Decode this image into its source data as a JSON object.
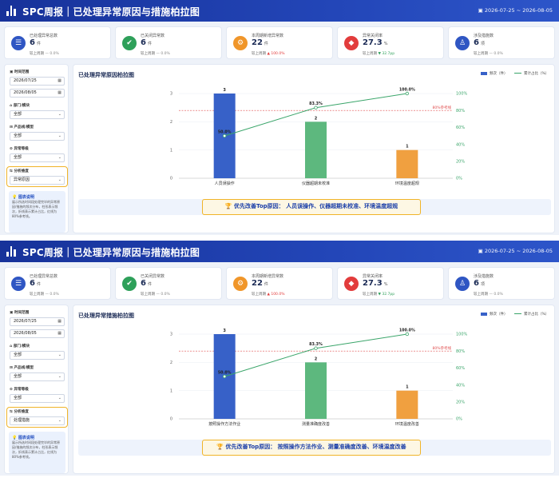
{
  "header": {
    "title": "SPC周报｜已处理异常原因与措施柏拉图",
    "date_range": "▣ 2026-07-25 ~ 2026-08-05"
  },
  "kpis": [
    {
      "label": "已处理异常总数",
      "value": "6",
      "unit": "件",
      "compare": "较上周期 — 0.0%",
      "trend": "flat",
      "icon": "list-icon",
      "glyph": "☰",
      "color": "#2f56c3"
    },
    {
      "label": "已关闭异常数",
      "value": "6",
      "unit": "件",
      "compare": "较上周期 — 0.0%",
      "trend": "flat",
      "icon": "check-icon",
      "glyph": "✔",
      "color": "#2ea05a"
    },
    {
      "label": "本周期新增异常数",
      "value": "22",
      "unit": "件",
      "compare": "较上周期 ▲ 100.0%",
      "trend": "up",
      "icon": "gear-icon",
      "glyph": "⚙",
      "color": "#f0962a"
    },
    {
      "label": "异常关闭率",
      "value": "27.3",
      "unit": "%",
      "compare": "较上周期 ▼ 32.7pp",
      "trend": "down",
      "icon": "diamond-icon",
      "glyph": "◆",
      "color": "#e23c3c"
    },
    {
      "label": "涉及措施数",
      "value": "6",
      "unit": "项",
      "compare": "较上周期 — 0.0%",
      "trend": "flat",
      "icon": "flask-icon",
      "glyph": "♙",
      "color": "#2f56c3"
    }
  ],
  "filters": {
    "time_label": "▣ 时间范围",
    "date_start": "2026/07/25",
    "date_end": "2026/08/05",
    "dept_label": "⌂ 部门/模块",
    "dept_value": "全部",
    "line_label": "⊞ 产品线/模型",
    "line_value": "全部",
    "level_label": "⊙ 异常等级",
    "level_value": "全部",
    "dim_label": "⇆ 分析维度",
    "note_title": "💡 图表说明",
    "note_body": "展示所选时间段处理完毕的异常原因/措施的频次分布，柱形表示频次，折线表示累计占比，红线为80%参考线。"
  },
  "legend": {
    "bar": "频次（件）",
    "line": "累计占比（%）"
  },
  "frames": [
    {
      "dimension_value": "异常原因",
      "chart_title": "已处理异常原因柏拉图",
      "banner": "🏆 优先改善Top原因： 人员误操作、仪器超期未校准、环境温度超规",
      "chart_data": {
        "type": "bar",
        "categories": [
          "人员误操作",
          "仪器超期未校准",
          "环境温度超规"
        ],
        "series": [
          {
            "name": "频次（件）",
            "kind": "bar",
            "values": [
              3,
              2,
              1
            ],
            "colors": [
              "#3761c8",
              "#5db87e",
              "#f0a040"
            ]
          },
          {
            "name": "累计占比（%）",
            "kind": "line",
            "values": [
              50.0,
              83.3,
              100.0
            ],
            "labels": [
              "50.0%",
              "83.3%",
              "100.0%"
            ],
            "color": "#3aa56a"
          }
        ],
        "ylim": [
          0,
          3
        ],
        "yticks": [
          "0",
          "1",
          "2",
          "3"
        ],
        "y2lim": [
          0,
          100
        ],
        "y2ticks": [
          "0%",
          "20%",
          "40%",
          "60%",
          "80%",
          "100%"
        ],
        "bar_labels": [
          "3",
          "2",
          "1"
        ],
        "reference": {
          "value": 80,
          "label": "80%参考线",
          "color": "#e05050"
        },
        "legend": "top-right"
      }
    },
    {
      "dimension_value": "处理措施",
      "chart_title": "已处理异常措施柏拉图",
      "banner": "🏆 优先改善Top原因： 按照操作方法作业、测量准确度改善、环境温度改善",
      "chart_data": {
        "type": "bar",
        "categories": [
          "按照操作方法作业",
          "测量准确度改善",
          "环境温度改善"
        ],
        "series": [
          {
            "name": "频次（件）",
            "kind": "bar",
            "values": [
              3,
              2,
              1
            ],
            "colors": [
              "#3761c8",
              "#5db87e",
              "#f0a040"
            ]
          },
          {
            "name": "累计占比（%）",
            "kind": "line",
            "values": [
              50.0,
              83.3,
              100.0
            ],
            "labels": [
              "50.0%",
              "83.3%",
              "100.0%"
            ],
            "color": "#3aa56a"
          }
        ],
        "ylim": [
          0,
          3
        ],
        "yticks": [
          "0",
          "1",
          "2",
          "3"
        ],
        "y2lim": [
          0,
          100
        ],
        "y2ticks": [
          "0%",
          "20%",
          "40%",
          "60%",
          "80%",
          "100%"
        ],
        "bar_labels": [
          "3",
          "2",
          "1"
        ],
        "reference": {
          "value": 80,
          "label": "80%参考线",
          "color": "#e05050"
        },
        "legend": "top-right"
      }
    }
  ]
}
